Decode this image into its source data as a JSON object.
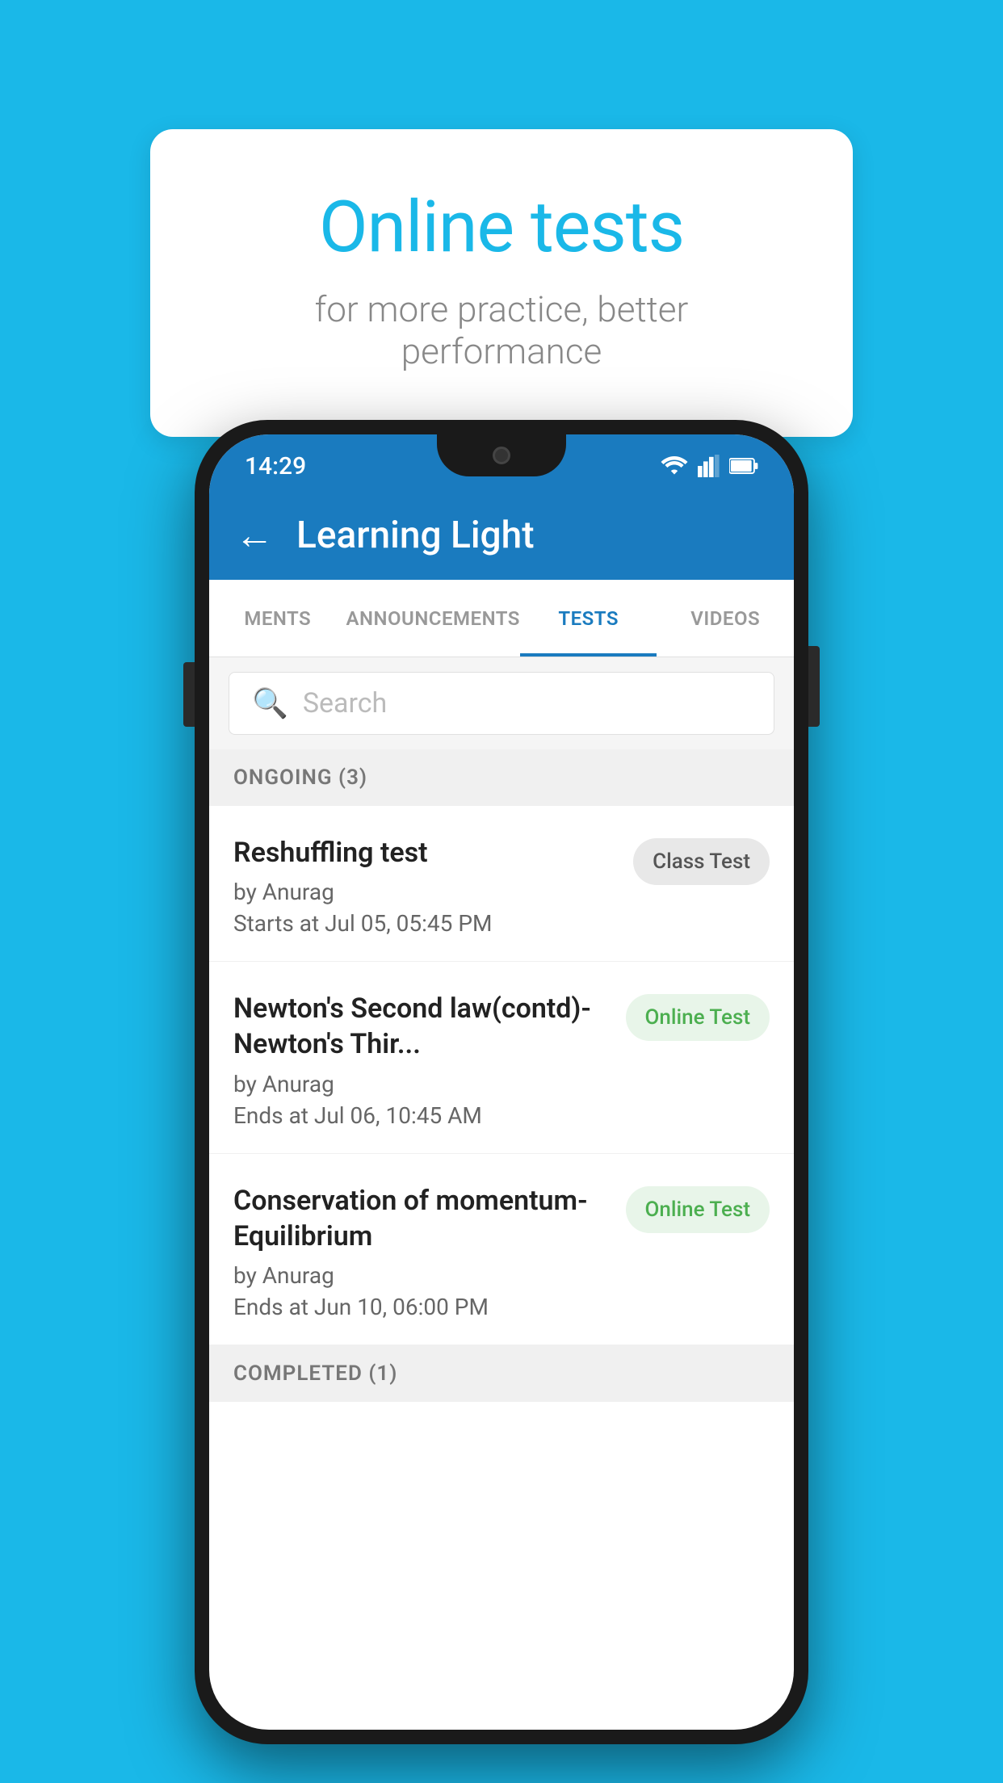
{
  "background": {
    "color": "#1ab8e8"
  },
  "speech_bubble": {
    "title": "Online tests",
    "subtitle": "for more practice, better performance"
  },
  "status_bar": {
    "time": "14:29"
  },
  "app_bar": {
    "title": "Learning Light",
    "back_label": "←"
  },
  "tabs": [
    {
      "id": "ments",
      "label": "MENTS",
      "active": false
    },
    {
      "id": "announcements",
      "label": "ANNOUNCEMENTS",
      "active": false
    },
    {
      "id": "tests",
      "label": "TESTS",
      "active": true
    },
    {
      "id": "videos",
      "label": "VIDEOS",
      "active": false
    }
  ],
  "search": {
    "placeholder": "Search"
  },
  "sections": {
    "ongoing": {
      "label": "ONGOING (3)"
    },
    "completed": {
      "label": "COMPLETED (1)"
    }
  },
  "tests": [
    {
      "id": "test-1",
      "name": "Reshuffling test",
      "author": "by Anurag",
      "date": "Starts at  Jul 05, 05:45 PM",
      "badge": "Class Test",
      "badge_type": "class"
    },
    {
      "id": "test-2",
      "name": "Newton's Second law(contd)-Newton's Thir...",
      "author": "by Anurag",
      "date": "Ends at  Jul 06, 10:45 AM",
      "badge": "Online Test",
      "badge_type": "online"
    },
    {
      "id": "test-3",
      "name": "Conservation of momentum-Equilibrium",
      "author": "by Anurag",
      "date": "Ends at  Jun 10, 06:00 PM",
      "badge": "Online Test",
      "badge_type": "online"
    }
  ]
}
